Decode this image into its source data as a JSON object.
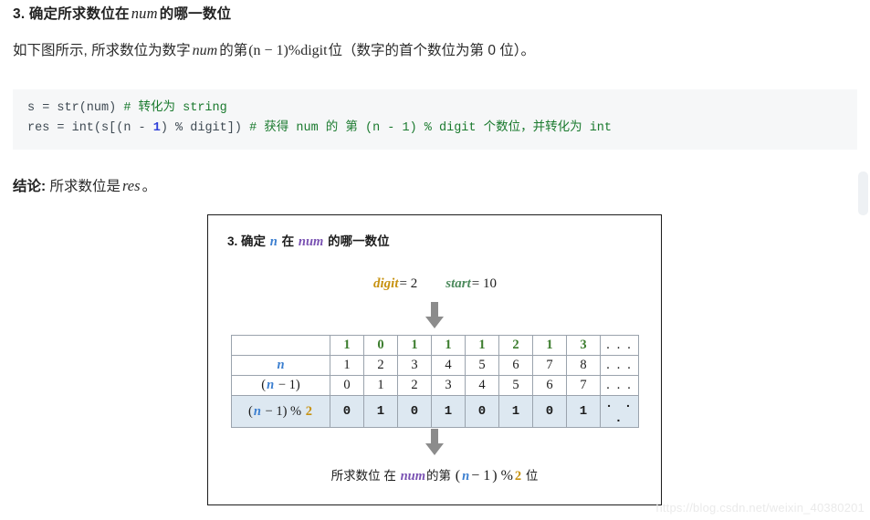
{
  "heading": {
    "prefix": "3. 确定所求数位在",
    "math": "num",
    "suffix": "的哪一数位"
  },
  "paragraph": {
    "part1": "如下图所示, 所求数位为数字",
    "math1": "num",
    "part2": "的第",
    "math2": "(n − 1)%digit",
    "part3": "位（数字的首个数位为第 0 位）。"
  },
  "code": {
    "line1": {
      "code": "s = str(num) ",
      "comment": "# 转化为 string"
    },
    "line2": {
      "pre": "res = int(s[(n - ",
      "num": "1",
      "post": ") % digit]) ",
      "comment": "# 获得 num 的 第 (n - 1) % digit 个数位，并转化为 int"
    }
  },
  "conclusion": {
    "label": "结论:",
    "text_pre": "所求数位是",
    "math": "res",
    "text_post": "。"
  },
  "figure": {
    "title": {
      "prefix": "3. 确定",
      "var_n": "n",
      "middle": "在",
      "var_num": "num",
      "suffix": "的哪一数位"
    },
    "vars": {
      "digit_name": "digit",
      "digit_eq": "= 2",
      "start_name": "start",
      "start_eq": "= 10"
    },
    "table": {
      "row_labels": [
        "",
        "n",
        "(n − 1)",
        "(n − 1) % 2"
      ],
      "top_groups": [
        [
          "1",
          "0"
        ],
        [
          "1",
          "1"
        ],
        [
          "1",
          "2"
        ],
        [
          "1",
          "3"
        ]
      ],
      "row_n": [
        "1",
        "2",
        "3",
        "4",
        "5",
        "6",
        "7",
        "8"
      ],
      "row_n_minus_1": [
        "0",
        "1",
        "2",
        "3",
        "4",
        "5",
        "6",
        "7"
      ],
      "row_mod": [
        "0",
        "1",
        "0",
        "1",
        "0",
        "1",
        "0",
        "1"
      ],
      "ellipsis": ". . ."
    },
    "caption": {
      "p1": "所求数位 在",
      "var_num": "num",
      "p2": "的第",
      "open": "(",
      "var_n": "n",
      "minus": "− 1",
      "close": ") %",
      "var_2": "2",
      "p3": "位"
    }
  },
  "watermark": "https://blog.csdn.net/weixin_40380201",
  "colors": {
    "n": "#3c7fd0",
    "num": "#7a52b3",
    "digit": "#c79211",
    "start": "#4c8a5c",
    "green_digits": "#3c7d2e",
    "highlight_row": "#dde8f1",
    "code_bg": "#f6f7f8",
    "comment": "#1a7a2e",
    "number_token": "#2f40d8"
  }
}
